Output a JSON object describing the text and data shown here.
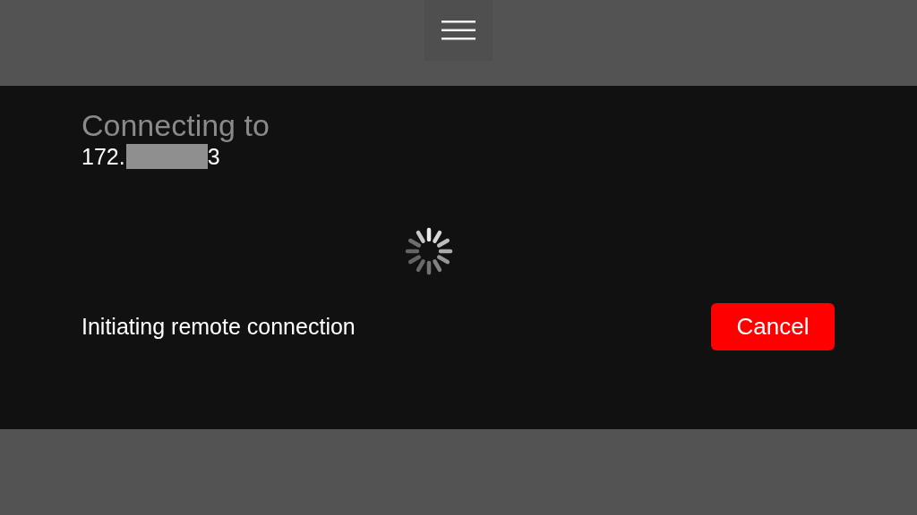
{
  "connection": {
    "heading": "Connecting to",
    "address_start": "172.",
    "address_end": "3"
  },
  "status": {
    "message": "Initiating remote connection"
  },
  "cancel_button": {
    "label": "Cancel"
  }
}
